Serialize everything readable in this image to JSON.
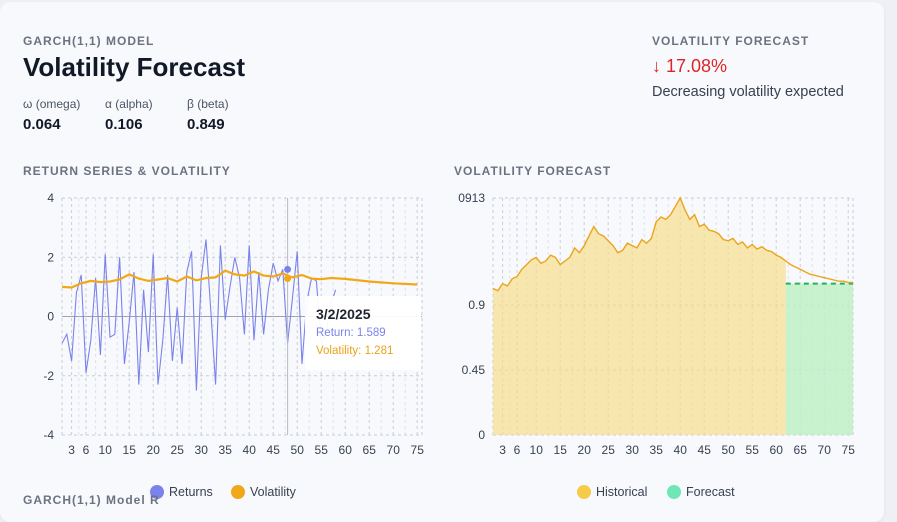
{
  "header": {
    "model_label": "GARCH(1,1) MODEL",
    "title": "Volatility Forecast",
    "params": [
      {
        "label": "ω (omega)",
        "value": "0.064"
      },
      {
        "label": "α (alpha)",
        "value": "0.106"
      },
      {
        "label": "β (beta)",
        "value": "0.849"
      }
    ]
  },
  "forecast_summary": {
    "label": "VOLATILITY FORECAST",
    "change": "↓ 17.08%",
    "description": "Decreasing volatility expected",
    "color": "#dc2626"
  },
  "left_panel": {
    "title": "RETURN SERIES & VOLATILITY"
  },
  "right_panel": {
    "title": "VOLATILITY FORECAST"
  },
  "tooltip": {
    "date": "3/2/2025",
    "return_text": "Return: 1.589",
    "volatility_text": "Volatility: 1.281"
  },
  "legends": {
    "left": [
      {
        "label": "Returns",
        "color": "#7b83eb"
      },
      {
        "label": "Volatility",
        "color": "#f0a818"
      }
    ],
    "right": [
      {
        "label": "Historical",
        "color": "#f5cc4a"
      },
      {
        "label": "Forecast",
        "color": "#6ee7b7"
      }
    ]
  },
  "footer_partial": "GARCH(1,1) Model R",
  "chart_data": [
    {
      "type": "line",
      "title": "RETURN SERIES & VOLATILITY",
      "x_ticks": [
        "3",
        "6",
        "10",
        "15",
        "20",
        "25",
        "30",
        "35",
        "40",
        "45",
        "50",
        "55",
        "60",
        "65",
        "70",
        "75"
      ],
      "y_ticks": [
        "4",
        "2",
        "0",
        "-2",
        "-4"
      ],
      "ylim": [
        -4,
        4
      ],
      "xlim": [
        1,
        76
      ],
      "series": [
        {
          "name": "Returns",
          "color": "#7b83eb",
          "x": [
            1,
            2,
            3,
            4,
            5,
            6,
            7,
            8,
            9,
            10,
            11,
            12,
            13,
            14,
            15,
            16,
            17,
            18,
            19,
            20,
            21,
            22,
            23,
            24,
            25,
            26,
            27,
            28,
            29,
            30,
            31,
            32,
            33,
            34,
            35,
            36,
            37,
            38,
            39,
            40,
            41,
            42,
            43,
            44,
            45,
            46,
            47,
            48,
            49,
            50,
            51,
            52,
            53,
            54,
            55,
            56,
            57,
            58
          ],
          "values": [
            -0.9,
            -0.6,
            -1.5,
            0.8,
            1.4,
            -1.9,
            -0.8,
            1.3,
            -1.3,
            2.1,
            -0.7,
            -0.6,
            2.0,
            -1.6,
            -0.2,
            1.5,
            -2.3,
            0.9,
            -1.2,
            2.1,
            -2.3,
            -0.8,
            1.4,
            -1.5,
            0.3,
            -1.6,
            1.5,
            2.2,
            -2.5,
            1.3,
            2.6,
            0.2,
            -2.3,
            2.4,
            -0.1,
            1.0,
            2.0,
            1.3,
            -0.6,
            2.4,
            -0.8,
            1.5,
            -0.6,
            0.9,
            1.8,
            1.2,
            1.589,
            -0.9,
            0.6,
            2.2,
            -1.6,
            0.5,
            1.3,
            1.2,
            -0.9,
            -0.6,
            0.4,
            0.9
          ]
        },
        {
          "name": "Volatility",
          "color": "#f0a818",
          "x": [
            1,
            3,
            5,
            7,
            9,
            11,
            13,
            15,
            17,
            19,
            21,
            23,
            25,
            27,
            29,
            31,
            33,
            35,
            37,
            39,
            41,
            43,
            45,
            47,
            49,
            51,
            53,
            55,
            57,
            60,
            65,
            70,
            75
          ],
          "values": [
            1.0,
            0.98,
            1.12,
            1.2,
            1.16,
            1.18,
            1.25,
            1.42,
            1.28,
            1.2,
            1.25,
            1.3,
            1.18,
            1.35,
            1.22,
            1.3,
            1.32,
            1.55,
            1.42,
            1.38,
            1.52,
            1.38,
            1.35,
            1.45,
            1.32,
            1.4,
            1.28,
            1.26,
            1.3,
            1.27,
            1.18,
            1.12,
            1.08
          ]
        }
      ]
    },
    {
      "type": "area",
      "title": "VOLATILITY FORECAST",
      "x_ticks": [
        "3",
        "6",
        "10",
        "15",
        "20",
        "25",
        "30",
        "35",
        "40",
        "45",
        "50",
        "55",
        "60",
        "65",
        "70",
        "75"
      ],
      "y_ticks": [
        "0913",
        "0.9",
        "0.45",
        "0"
      ],
      "ylim": [
        0,
        1.8
      ],
      "xlim": [
        1,
        76
      ],
      "series": [
        {
          "name": "Historical",
          "color": "#f5cc4a",
          "x": [
            1,
            2,
            3,
            4,
            5,
            6,
            7,
            8,
            9,
            10,
            11,
            12,
            13,
            14,
            15,
            16,
            17,
            18,
            19,
            20,
            21,
            22,
            23,
            24,
            25,
            26,
            27,
            28,
            29,
            30,
            31,
            32,
            33,
            34,
            35,
            36,
            37,
            38,
            39,
            40,
            41,
            42,
            43,
            44,
            45,
            46,
            47,
            48,
            49,
            50,
            51,
            52,
            53,
            54,
            55,
            56,
            57,
            58,
            59,
            60,
            61,
            62,
            63,
            64,
            65,
            66,
            67,
            68,
            69,
            70,
            71,
            72,
            73,
            74,
            75,
            76
          ],
          "values": [
            1.04,
            1.02,
            1.08,
            1.06,
            1.12,
            1.14,
            1.2,
            1.24,
            1.28,
            1.3,
            1.25,
            1.27,
            1.32,
            1.3,
            1.24,
            1.27,
            1.3,
            1.38,
            1.34,
            1.4,
            1.48,
            1.56,
            1.5,
            1.48,
            1.44,
            1.4,
            1.34,
            1.36,
            1.42,
            1.4,
            1.38,
            1.45,
            1.42,
            1.46,
            1.6,
            1.64,
            1.62,
            1.66,
            1.73,
            1.8,
            1.7,
            1.62,
            1.66,
            1.56,
            1.58,
            1.53,
            1.52,
            1.5,
            1.45,
            1.44,
            1.46,
            1.41,
            1.43,
            1.38,
            1.41,
            1.37,
            1.39,
            1.36,
            1.35,
            1.32,
            1.3,
            1.27,
            1.24,
            1.22,
            1.2,
            1.18,
            1.16,
            1.15,
            1.14,
            1.13,
            1.12,
            1.11,
            1.1,
            1.1,
            1.09,
            1.09
          ]
        },
        {
          "name": "Forecast",
          "color": "#6ee7b7",
          "x": [
            62,
            76
          ],
          "values": [
            1.08,
            1.08
          ]
        }
      ]
    }
  ]
}
